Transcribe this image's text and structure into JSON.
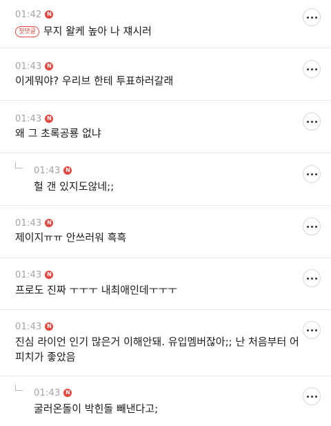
{
  "comments": [
    {
      "time": "01:42",
      "new_badge": "N",
      "first_badge": "첫댓글",
      "text": "무지 왈케 높아 나 쟤시러",
      "reply": false
    },
    {
      "time": "01:43",
      "new_badge": "N",
      "text": "이게뭐야? 우리브 한테 투표하러갈래",
      "reply": false
    },
    {
      "time": "01:43",
      "new_badge": "N",
      "text": "왜 그 초록공룡 없냐",
      "reply": false
    },
    {
      "time": "01:43",
      "new_badge": "N",
      "text": "헐 갠 있지도않네;;",
      "reply": true
    },
    {
      "time": "01:43",
      "new_badge": "N",
      "text": "제이지ㅠㅠ 안쓰러워 흑흑",
      "reply": false
    },
    {
      "time": "01:43",
      "new_badge": "N",
      "text": "프로도 진짜 ㅜㅜㅜ 내최애인데ㅜㅜㅜ",
      "reply": false
    },
    {
      "time": "01:43",
      "new_badge": "N",
      "text": "진심 라이언 인기 많은거 이해안돼. 유입멤버잖아;; 난 처음부터 어피치가 좋았음",
      "reply": false
    },
    {
      "time": "01:43",
      "new_badge": "N",
      "text": "굴러온돌이 박힌돌 빼낸다고;",
      "reply": true
    }
  ],
  "more_icon": "more-horizontal-icon",
  "reply_icon": "reply-arrow-icon",
  "accent_color": "#e5473e"
}
